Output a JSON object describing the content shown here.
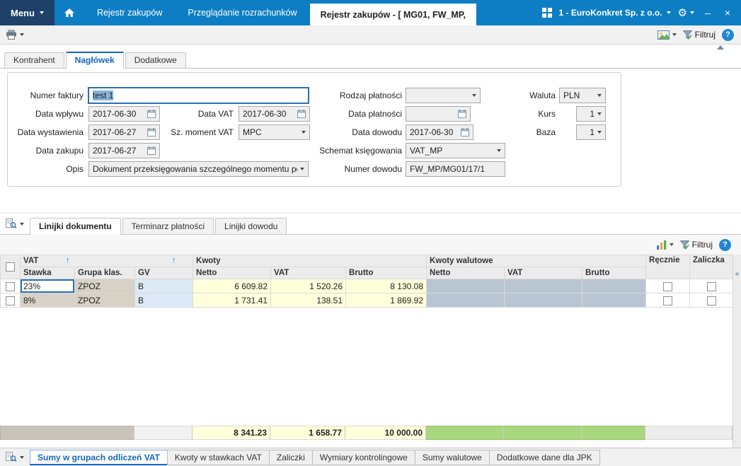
{
  "topbar": {
    "menu": "Menu",
    "nav": [
      {
        "label": "Rejestr zakupów"
      },
      {
        "label": "Przeglądanie rozrachunków"
      },
      {
        "label": "Rejestr zakupów - [ MG01, FW_MP,"
      }
    ],
    "company": "1 - EuroKonkret Sp. z o.o."
  },
  "toolbar": {
    "filtruj": "Filtruj"
  },
  "icons": {
    "help": "?",
    "sort_up": "↑",
    "collapse_left": "«"
  },
  "header_tabs": [
    {
      "label": "Kontrahent"
    },
    {
      "label": "Nagłówek"
    },
    {
      "label": "Dodatkowe"
    }
  ],
  "form": {
    "numer_faktury": {
      "label": "Numer faktury",
      "value": "test 1"
    },
    "data_wplywu": {
      "label": "Data wpływu",
      "value": "2017-06-30"
    },
    "data_wystawienia": {
      "label": "Data wystawienia",
      "value": "2017-06-27"
    },
    "data_zakupu": {
      "label": "Data zakupu",
      "value": "2017-06-27"
    },
    "opis": {
      "label": "Opis",
      "value": "Dokument przeksięgowania szczególnego momentu podatk"
    },
    "data_vat": {
      "label": "Data VAT",
      "value": "2017-06-30"
    },
    "sz_moment_vat": {
      "label": "Sz. moment VAT",
      "value": "MPC"
    },
    "rodzaj_platnosci": {
      "label": "Rodzaj płatności",
      "value": ""
    },
    "data_platnosci": {
      "label": "Data płatności",
      "value": ""
    },
    "data_dowodu": {
      "label": "Data dowodu",
      "value": "2017-06-30"
    },
    "schemat_ksiegowania": {
      "label": "Schemat księgowania",
      "value": "VAT_MP"
    },
    "numer_dowodu": {
      "label": "Numer dowodu",
      "value": "FW_MP/MG01/17/1"
    },
    "waluta": {
      "label": "Waluta",
      "value": "PLN"
    },
    "kurs": {
      "label": "Kurs",
      "value": "1"
    },
    "baza": {
      "label": "Baza",
      "value": "1"
    }
  },
  "detail_tabs": [
    {
      "label": "Linijki dokumentu"
    },
    {
      "label": "Terminarz płatności"
    },
    {
      "label": "Linijki dowodu"
    }
  ],
  "grid": {
    "filtruj": "Filtruj",
    "groups": {
      "vat": "VAT",
      "kwoty": "Kwoty",
      "kwoty_walutowe": "Kwoty walutowe",
      "recznie": "Ręcznie",
      "zaliczka": "Zaliczka"
    },
    "columns": {
      "stawka": "Stawka",
      "grupa": "Grupa klas.",
      "gv": "GV",
      "netto": "Netto",
      "vat": "VAT",
      "brutto": "Brutto"
    },
    "rows": [
      {
        "stawka": "23%",
        "grupa": "ZPOZ",
        "gv": "B",
        "netto": "6 609.82",
        "vat": "1 520.26",
        "brutto": "8 130.08",
        "netto_wal": "",
        "vat_wal": "",
        "brutto_wal": ""
      },
      {
        "stawka": "8%",
        "grupa": "ZPOZ",
        "gv": "B",
        "netto": "1 731.41",
        "vat": "138.51",
        "brutto": "1 869.92",
        "netto_wal": "",
        "vat_wal": "",
        "brutto_wal": ""
      }
    ],
    "summary": {
      "netto": "8 341.23",
      "vat": "1 658.77",
      "brutto": "10 000.00"
    }
  },
  "bottom_tabs": [
    {
      "label": "Sumy w grupach odliczeń VAT"
    },
    {
      "label": "Kwoty w stawkach VAT"
    },
    {
      "label": "Zaliczki"
    },
    {
      "label": "Wymiary kontrolingowe"
    },
    {
      "label": "Sumy walutowe"
    },
    {
      "label": "Dodatkowe dane dla JPK"
    }
  ],
  "colors": {
    "topbar_blue": "#0d7ec3",
    "menu_navy": "#1d4168",
    "accent_blue": "#1566c0",
    "cell_yellow": "#ffffdc",
    "cell_green": "#a9d77e",
    "cell_taupe": "#d7d1c6",
    "cell_bluegray": "#b9c5d2",
    "cell_lightblue": "#dce9f6"
  }
}
